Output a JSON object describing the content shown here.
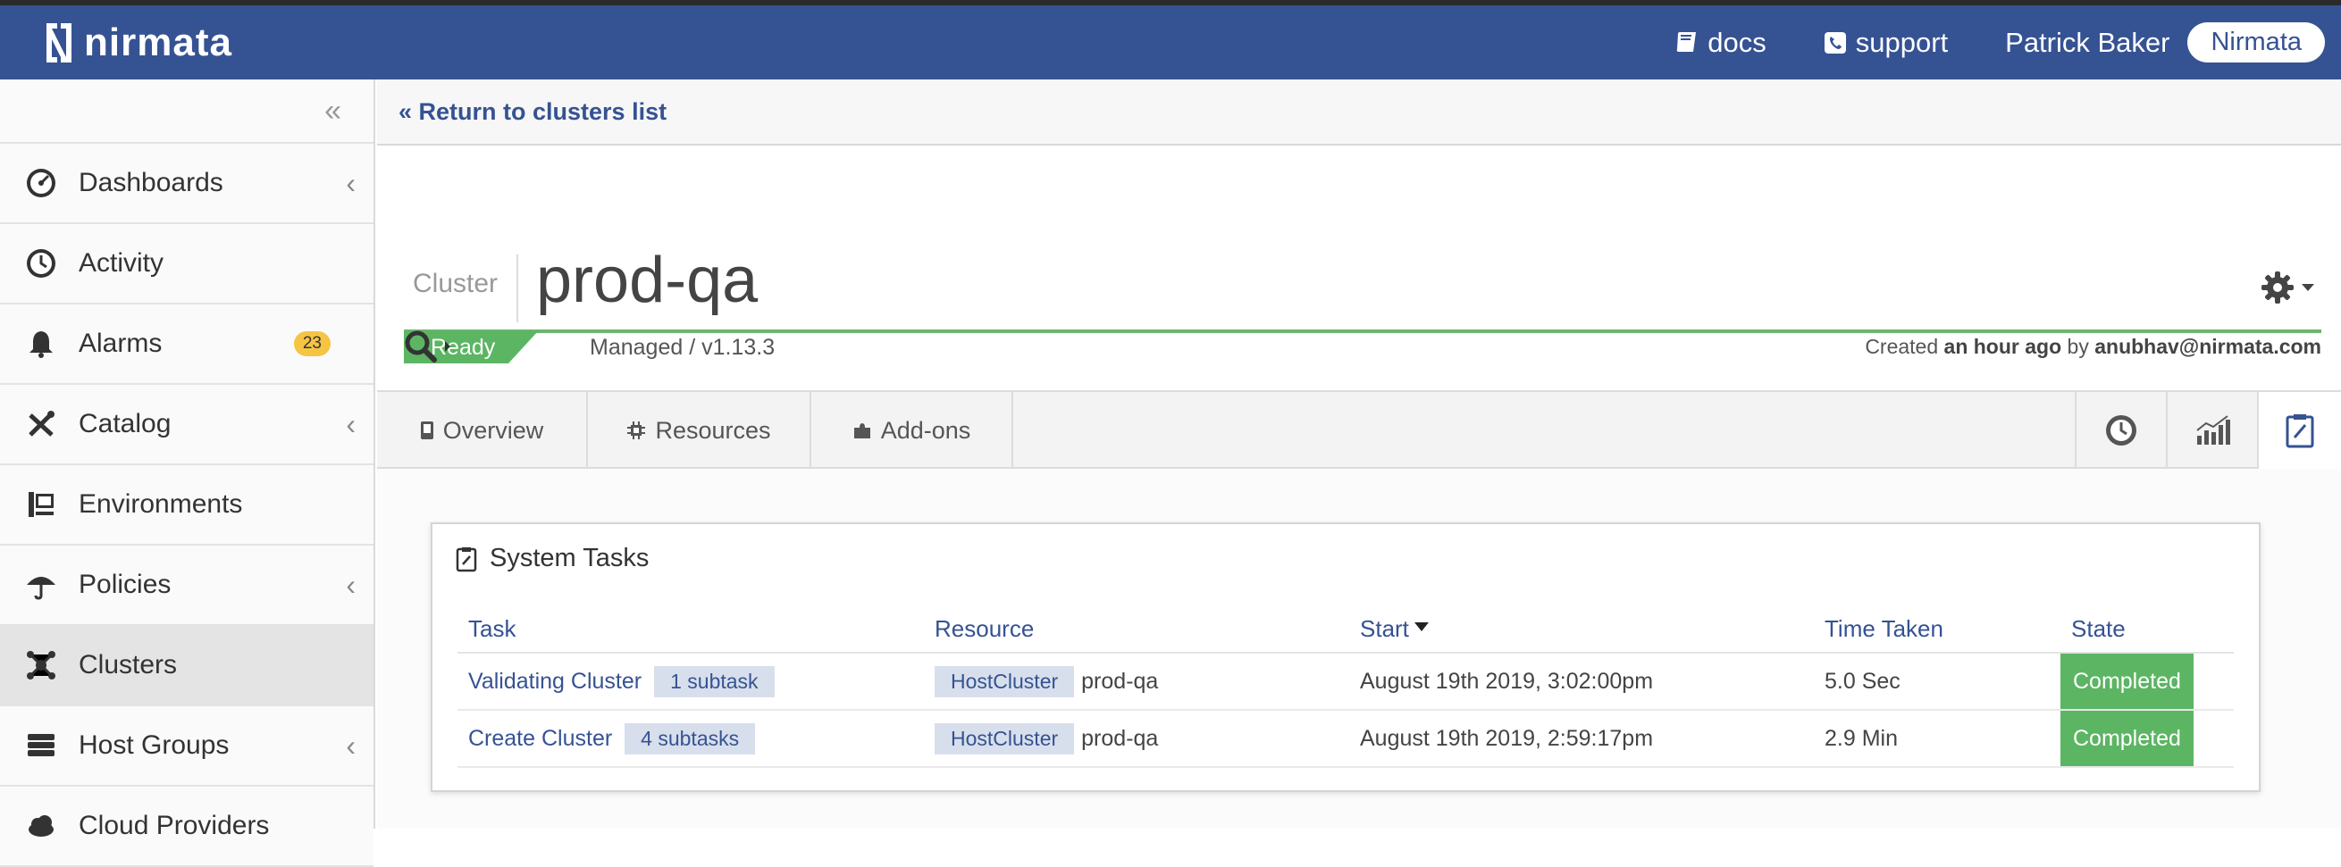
{
  "topbar": {
    "brand": "nirmata",
    "docs_label": "docs",
    "support_label": "support",
    "user_name": "Patrick Baker",
    "org_name": "Nirmata",
    "color": "#355293"
  },
  "sidebar": {
    "collapse_icon": "double-chevron-left-icon",
    "items": [
      {
        "label": "Dashboards",
        "icon": "dashboard-gauge-icon",
        "has_submenu": true
      },
      {
        "label": "Activity",
        "icon": "clock-icon",
        "has_submenu": false
      },
      {
        "label": "Alarms",
        "icon": "bell-icon",
        "badge": "23"
      },
      {
        "label": "Catalog",
        "icon": "tools-icon",
        "has_submenu": true
      },
      {
        "label": "Environments",
        "icon": "environments-icon",
        "has_submenu": false
      },
      {
        "label": "Policies",
        "icon": "umbrella-icon",
        "has_submenu": true
      },
      {
        "label": "Clusters",
        "icon": "cluster-nodes-icon",
        "active": true
      },
      {
        "label": "Host Groups",
        "icon": "server-stack-icon",
        "has_submenu": true
      },
      {
        "label": "Cloud Providers",
        "icon": "cloud-icon"
      }
    ]
  },
  "main": {
    "return_link": "Return to clusters list",
    "cluster_kind": "Cluster",
    "cluster_name": "prod-qa",
    "status": "Ready",
    "managed_text": "Managed / v1.13.3",
    "created_prefix": "Created",
    "created_when": "an hour ago",
    "created_by_word": "by",
    "created_by": "anubhav@nirmata.com",
    "tabs": [
      {
        "label": "Overview",
        "icon": "phone-icon"
      },
      {
        "label": "Resources",
        "icon": "chip-icon"
      },
      {
        "label": "Add-ons",
        "icon": "puzzle-icon"
      }
    ],
    "right_tabs": [
      "history-clock-icon",
      "bar-chart-icon",
      "clipboard-task-icon"
    ],
    "panel": {
      "title": "System Tasks",
      "columns": [
        "Task",
        "Resource",
        "Start",
        "Time Taken",
        "State"
      ],
      "rows": [
        {
          "task": "Validating Cluster",
          "subtasks": "1 subtask",
          "resource_type": "HostCluster",
          "resource_name": "prod-qa",
          "start": "August 19th 2019, 3:02:00pm",
          "time_taken": "5.0 Sec",
          "state": "Completed"
        },
        {
          "task": "Create Cluster",
          "subtasks": "4 subtasks",
          "resource_type": "HostCluster",
          "resource_name": "prod-qa",
          "start": "August 19th 2019, 2:59:17pm",
          "time_taken": "2.9 Min",
          "state": "Completed"
        }
      ]
    }
  }
}
